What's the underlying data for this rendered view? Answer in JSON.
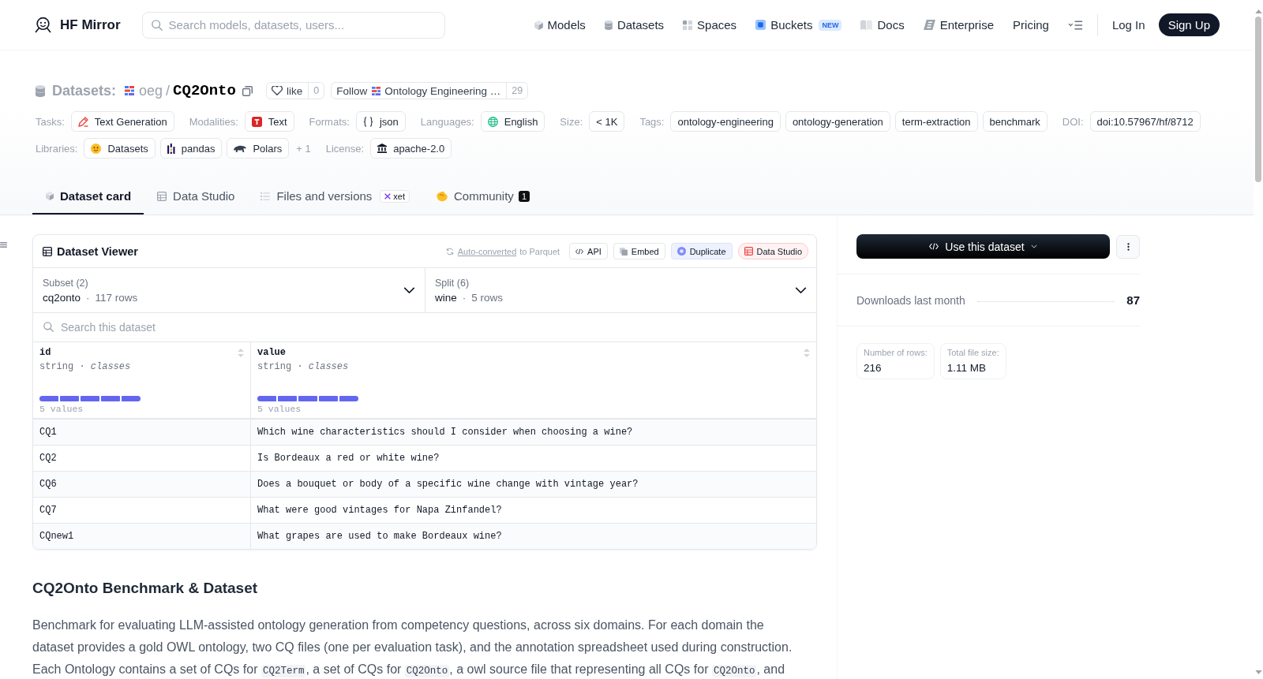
{
  "nav": {
    "brand": "HF Mirror",
    "search": {
      "placeholder": "Search models, datasets, users..."
    },
    "links": [
      {
        "kind": "models",
        "label": "Models"
      },
      {
        "kind": "datasets",
        "label": "Datasets"
      },
      {
        "kind": "spaces",
        "label": "Spaces"
      },
      {
        "kind": "buckets",
        "label": "Buckets",
        "badge": "NEW"
      },
      {
        "kind": "docs",
        "label": "Docs"
      },
      {
        "kind": "enterprise",
        "label": "Enterprise"
      },
      {
        "kind": "pricing",
        "label": "Pricing"
      }
    ],
    "login": "Log In",
    "signup": "Sign Up"
  },
  "header": {
    "section": "Datasets:",
    "owner": "oeg",
    "separator": "/",
    "name": "CQ2Onto",
    "like": {
      "label": "like",
      "count": "0"
    },
    "follow": {
      "label": "Follow",
      "org": "Ontology Engineering …",
      "count": "29"
    },
    "metadata": [
      [
        {
          "label": "Tasks:",
          "items": [
            {
              "kind": "task",
              "text": "Text Generation"
            }
          ]
        },
        {
          "label": "Modalities:",
          "items": [
            {
              "kind": "modality",
              "text": "Text"
            }
          ]
        },
        {
          "label": "Formats:",
          "items": [
            {
              "kind": "format",
              "text": "json"
            }
          ]
        },
        {
          "label": "Languages:",
          "items": [
            {
              "kind": "language",
              "text": "English"
            }
          ]
        },
        {
          "label": "Size:",
          "items": [
            {
              "kind": "size",
              "text": "< 1K"
            }
          ]
        },
        {
          "label": "Tags:",
          "items": [
            {
              "kind": "tag",
              "text": "ontology-engineering"
            },
            {
              "kind": "tag",
              "text": "ontology-generation"
            },
            {
              "kind": "tag",
              "text": "term-extraction"
            },
            {
              "kind": "tag",
              "text": "benchmark"
            }
          ]
        },
        {
          "label": "DOI:",
          "items": [
            {
              "kind": "doi",
              "text": "doi:10.57967/hf/8712"
            }
          ]
        }
      ],
      [
        {
          "label": "Libraries:",
          "items": [
            {
              "kind": "library-datasets",
              "text": "Datasets"
            },
            {
              "kind": "library-pandas",
              "text": "pandas"
            },
            {
              "kind": "library-polars",
              "text": "Polars"
            }
          ],
          "more": "+ 1"
        },
        {
          "label": "License:",
          "items": [
            {
              "kind": "license",
              "text": "apache-2.0"
            }
          ]
        }
      ]
    ]
  },
  "tabs": [
    {
      "kind": "card",
      "label": "Dataset card",
      "selected": true
    },
    {
      "kind": "studio",
      "label": "Data Studio",
      "selected": false
    },
    {
      "kind": "files",
      "label": "Files and versions",
      "badge": "xet",
      "selected": false
    },
    {
      "kind": "community",
      "label": "Community",
      "count": "1",
      "selected": false
    }
  ],
  "viewer": {
    "title": "Dataset Viewer",
    "conversion": {
      "link": "Auto-converted",
      "text": "to Parquet"
    },
    "actions": [
      {
        "kind": "api",
        "label": "API"
      },
      {
        "kind": "embed",
        "label": "Embed"
      },
      {
        "kind": "duplicate",
        "label": "Duplicate"
      },
      {
        "kind": "studio",
        "label": "Data Studio"
      }
    ],
    "subset": {
      "label": "Subset (2)",
      "value": "cq2onto",
      "separator": "·",
      "count": "117 rows"
    },
    "split": {
      "label": "Split (6)",
      "value": "wine",
      "separator": "·",
      "count": "5 rows"
    },
    "search": {
      "placeholder": "Search this dataset"
    },
    "columns": [
      {
        "name": "id",
        "type": "string · *classes*",
        "summary": "5 values"
      },
      {
        "name": "value",
        "type": "string · *classes*",
        "summary": "5 values"
      }
    ],
    "rows": [
      [
        "CQ1",
        "Which wine characteristics should I consider when choosing a wine?"
      ],
      [
        "CQ2",
        "Is Bordeaux a red or white wine?"
      ],
      [
        "CQ6",
        "Does a bouquet or body of a specific wine change with vintage year?"
      ],
      [
        "CQ7",
        "What were good vintages for Napa Zinfandel?"
      ],
      [
        "CQnew1",
        "What grapes are used to make Bordeaux wine?"
      ]
    ]
  },
  "sidebar": {
    "use_button": "Use this dataset",
    "downloads": {
      "label": "Downloads last month",
      "value": "87"
    },
    "stats": [
      {
        "label": "Number of rows:",
        "value": "216"
      },
      {
        "label": "Total file size:",
        "value": "1.11 MB"
      }
    ]
  },
  "description": {
    "title": "CQ2Onto Benchmark & Dataset",
    "paragraph": [
      {
        "kind": "text",
        "text": "Benchmark for evaluating LLM-assisted ontology generation from competency questions, across six domains. For each domain the dataset provides a gold OWL ontology, two CQ files (one per evaluation task), and the annotation spreadsheet used during construction. Each Ontology contains a set of CQs for "
      },
      {
        "kind": "code",
        "text": "CQ2Term"
      },
      {
        "kind": "text",
        "text": ", a set of CQs for "
      },
      {
        "kind": "code",
        "text": "CQ2Onto"
      },
      {
        "kind": "text",
        "text": ", a owl source file that representing all CQs for "
      },
      {
        "kind": "code",
        "text": "CQ2Onto"
      },
      {
        "kind": "text",
        "text": ", and"
      }
    ]
  }
}
